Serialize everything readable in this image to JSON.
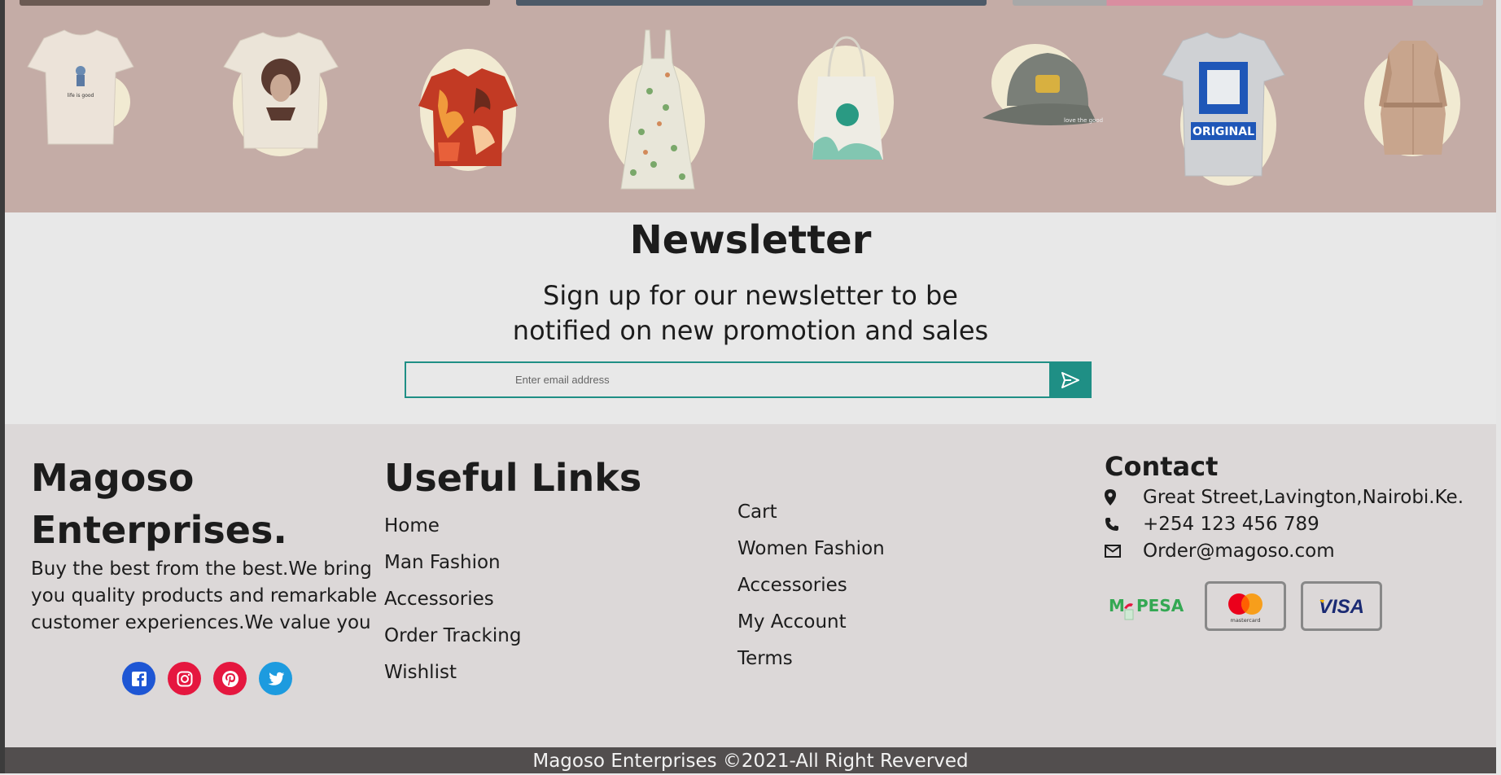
{
  "product_band": {
    "items": [
      {
        "icon": "tshirt-guitar-icon",
        "color": "#ece3d9"
      },
      {
        "icon": "tshirt-portrait-icon",
        "color": "#ebe4d8"
      },
      {
        "icon": "hawaiian-shirt-icon",
        "color": "#c23a24"
      },
      {
        "icon": "floral-dress-icon",
        "color": "#e8e6d9"
      },
      {
        "icon": "tote-bag-icon",
        "color": "#eeece4"
      },
      {
        "icon": "cap-icon",
        "color": "#7a7f78"
      },
      {
        "icon": "tshirt-original-icon",
        "color": "#cfd1d4"
      },
      {
        "icon": "trench-coat-icon",
        "color": "#c8a58d"
      }
    ]
  },
  "newsletter": {
    "title": "Newsletter",
    "subtitle_line1": "Sign up for our newsletter to be",
    "subtitle_line2": "notified on new promotion and sales",
    "email_placeholder": "Enter email address",
    "submit_icon": "send-icon"
  },
  "footer": {
    "brand": {
      "name_line1": "Magoso",
      "name_line2": "Enterprises.",
      "description": "Buy the best from the best.We bring you quality products and remarkable customer experiences.We value you"
    },
    "socials": [
      {
        "name": "facebook",
        "icon": "facebook-icon",
        "color": "#1e56d4"
      },
      {
        "name": "instagram",
        "icon": "instagram-icon",
        "color": "#e5173f"
      },
      {
        "name": "pinterest",
        "icon": "pinterest-icon",
        "color": "#e5173f"
      },
      {
        "name": "twitter",
        "icon": "twitter-icon",
        "color": "#1d9bdf"
      }
    ],
    "useful_links": {
      "title": "Useful Links",
      "column1": [
        "Home",
        "Man Fashion",
        "Accessories",
        "Order Tracking",
        "Wishlist"
      ],
      "column2": [
        "Cart",
        "Women Fashion",
        "Accessories",
        "My Account",
        "Terms"
      ]
    },
    "contact": {
      "title": "Contact",
      "address": "Great Street,Lavington,Nairobi.Ke.",
      "phone": "+254 123 456 789",
      "email": "Order@magoso.com",
      "payments": [
        {
          "name": "M-PESA",
          "label": "M PESA",
          "icon": "mpesa-logo"
        },
        {
          "name": "mastercard",
          "label": "mastercard",
          "icon": "mastercard-logo"
        },
        {
          "name": "visa",
          "label": "VISA",
          "icon": "visa-logo"
        }
      ]
    },
    "copyright": "Magoso Enterprises ©2021-All Right Reverved"
  },
  "colors": {
    "accent": "#1f8f85",
    "band": "#c4aca6",
    "footer_bg": "#dcd8d8",
    "copyright_bg": "#524e4e"
  }
}
